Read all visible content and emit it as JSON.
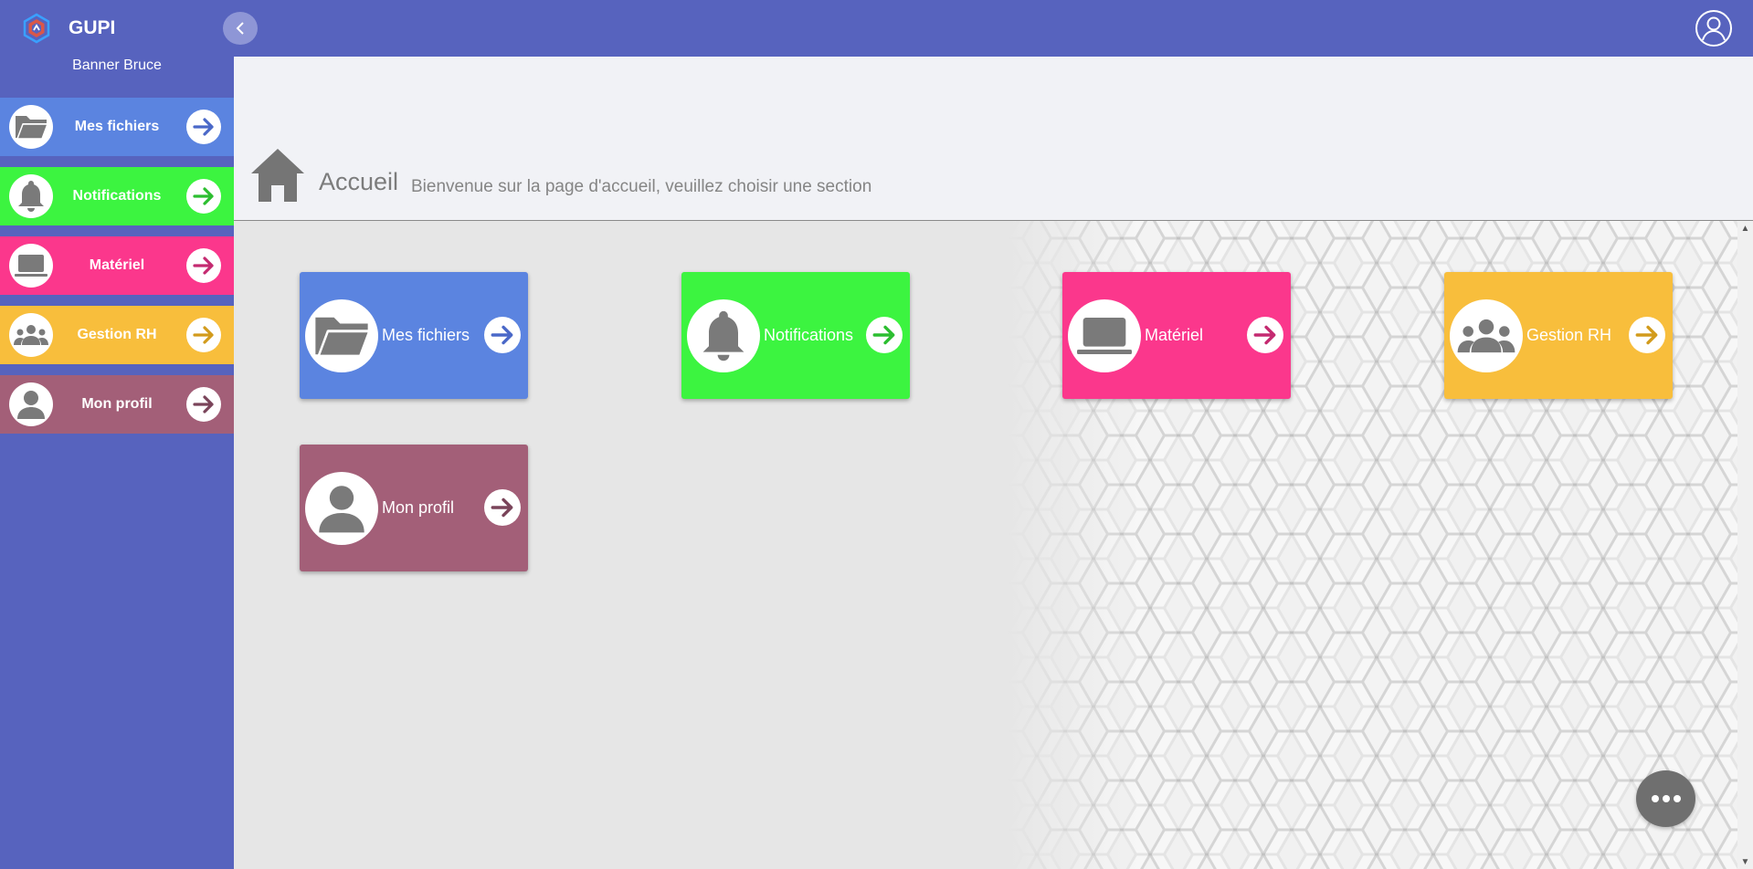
{
  "app": {
    "name": "GUPI"
  },
  "user": {
    "name": "Banner Bruce"
  },
  "sidebar": {
    "items": [
      {
        "label": "Mes fichiers",
        "icon": "folder-icon",
        "color": "#5b84e0",
        "arrow_color": "#4a68c8"
      },
      {
        "label": "Notifications",
        "icon": "bell-icon",
        "color": "#3cf440",
        "arrow_color": "#2cbe30"
      },
      {
        "label": "Matériel",
        "icon": "laptop-icon",
        "color": "#fb378c",
        "arrow_color": "#c42a70"
      },
      {
        "label": "Gestion RH",
        "icon": "group-icon",
        "color": "#f8be3c",
        "arrow_color": "#d29b1c"
      },
      {
        "label": "Mon profil",
        "icon": "person-icon",
        "color": "#a35f78",
        "arrow_color": "#7a445a"
      }
    ]
  },
  "header": {
    "title": "Accueil",
    "subtitle": "Bienvenue sur la page d'accueil, veuillez choisir une section"
  },
  "tiles": [
    {
      "label": "Mes fichiers",
      "icon": "folder-icon",
      "color": "#5b84e0",
      "arrow_color": "#4a68c8"
    },
    {
      "label": "Notifications",
      "icon": "bell-icon",
      "color": "#3cf440",
      "arrow_color": "#2cbe30"
    },
    {
      "label": "Matériel",
      "icon": "laptop-icon",
      "color": "#fb378c",
      "arrow_color": "#c42a70"
    },
    {
      "label": "Gestion RH",
      "icon": "group-icon",
      "color": "#f8be3c",
      "arrow_color": "#d29b1c"
    },
    {
      "label": "Mon profil",
      "icon": "person-icon",
      "color": "#a35f78",
      "arrow_color": "#7a445a"
    }
  ],
  "colors": {
    "primary": "#5763be",
    "header_bg": "#f1f2f6",
    "content_bg": "#e6e6e6",
    "icon_grey": "#7a7a7a"
  }
}
